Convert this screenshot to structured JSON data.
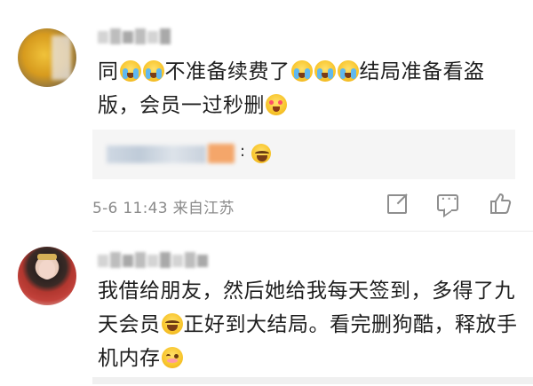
{
  "comments": [
    {
      "text_parts": [
        "同",
        "",
        "",
        "不准备续费了",
        "",
        "",
        "",
        "结局准备看盗版，会员一过秒删",
        ""
      ],
      "reply": {
        "colon": ":"
      },
      "meta": "5-6 11:43 来自江苏"
    },
    {
      "text_parts": [
        "我借给朋友，然后她给我每天签到，多得了九天会员",
        "",
        "正好到大结局。看完删狗酷，释放手机内存",
        ""
      ]
    }
  ],
  "icons": {
    "share": "share-icon",
    "comment": "comment-icon",
    "like": "like-icon"
  },
  "colors": {
    "meta_text": "#8a8a8a",
    "reply_background": "#f5f5f5",
    "body_text": "#1e1e1e"
  }
}
